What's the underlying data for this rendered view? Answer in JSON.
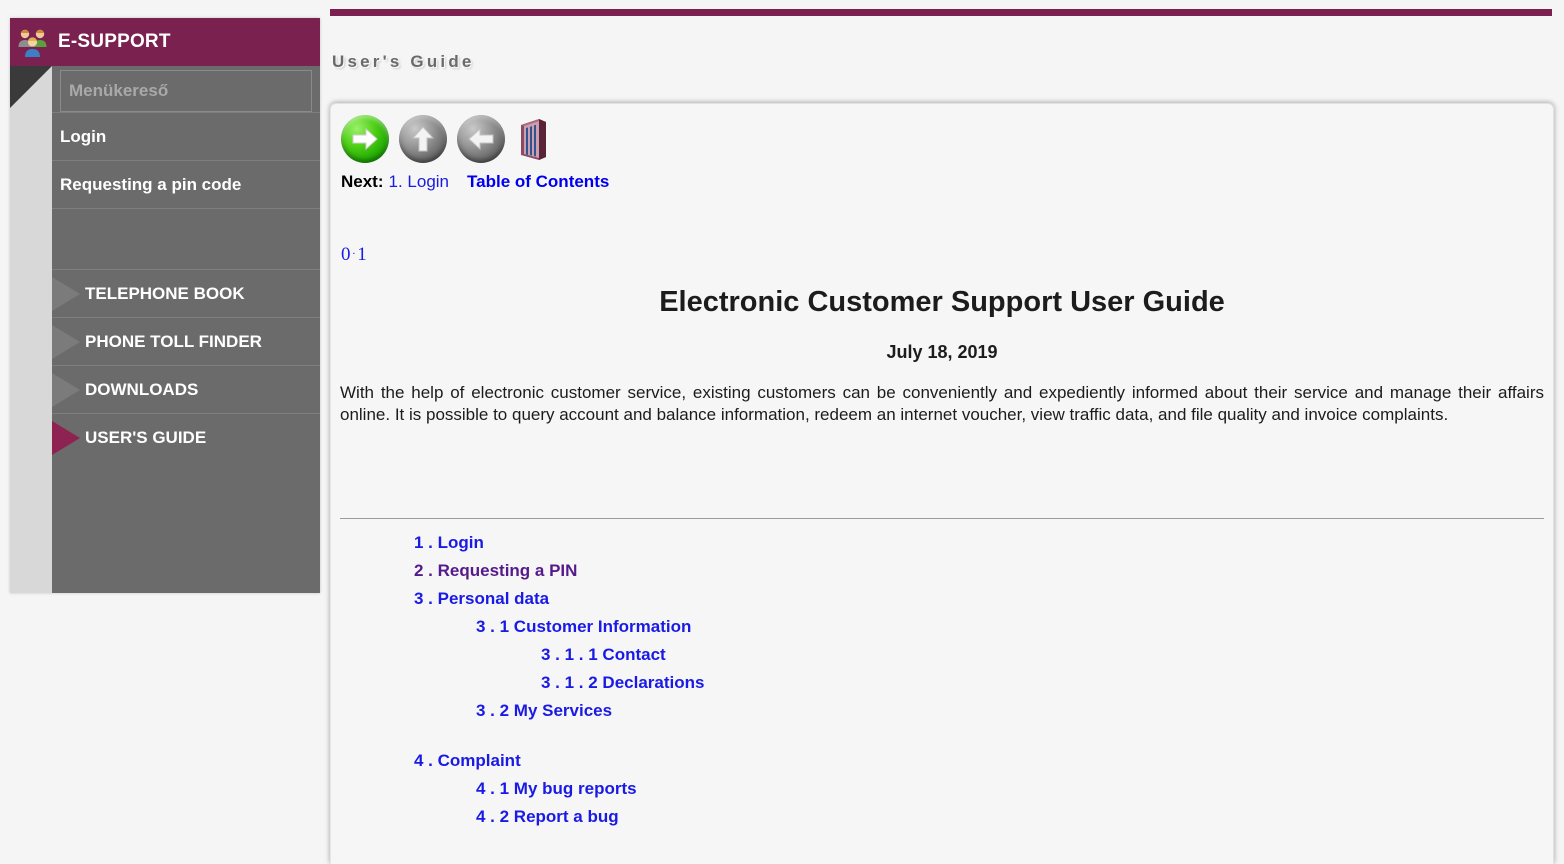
{
  "sidebar": {
    "brand": "E-SUPPORT",
    "logo_icon": "people-group-icon",
    "search_placeholder": "Menükereső",
    "search_value": "",
    "items": [
      {
        "label": "Login",
        "style": "plain",
        "active": false
      },
      {
        "label": "Requesting a pin code",
        "style": "plain",
        "active": false
      }
    ],
    "section_items": [
      {
        "label": "TELEPHONE BOOK",
        "active": false
      },
      {
        "label": "PHONE TOLL FINDER",
        "active": false
      },
      {
        "label": "DOWNLOADS",
        "active": false
      },
      {
        "label": "USER'S GUIDE",
        "active": true
      }
    ]
  },
  "page": {
    "title": "User's Guide"
  },
  "nav": {
    "forward_icon": "arrow-right-green-icon",
    "up_icon": "arrow-up-gray-icon",
    "back_icon": "arrow-left-gray-icon",
    "contents_icon": "book-icon",
    "next_label": "Next:",
    "next_link": "1. Login",
    "toc_link": "Table of Contents"
  },
  "version": {
    "major": "0",
    "separator": ".",
    "minor": "1"
  },
  "document": {
    "title": "Electronic Customer Support User Guide",
    "date": "July 18, 2019",
    "abstract": "With the help of electronic customer service, existing customers can be conveniently and expediently informed about their service and manage their affairs online. It is possible to query account and balance information, redeem an internet voucher, view traffic data, and file quality and invoice complaints."
  },
  "toc": [
    {
      "text": "1 . Login",
      "level": 1,
      "visited": false
    },
    {
      "text": "2 . Requesting a PIN",
      "level": 1,
      "visited": true
    },
    {
      "text": "3 . Personal data",
      "level": 1,
      "visited": false
    },
    {
      "text": "3 . 1 Customer Information",
      "level": 2,
      "visited": false
    },
    {
      "text": "3 . 1 . 1 Contact",
      "level": 3,
      "visited": false
    },
    {
      "text": "3 . 1 . 2 Declarations",
      "level": 3,
      "visited": false
    },
    {
      "text": "3 . 2 My Services",
      "level": 2,
      "visited": false
    },
    {
      "text": "",
      "level": 0,
      "visited": false
    },
    {
      "text": "4 . Complaint",
      "level": 1,
      "visited": false
    },
    {
      "text": "4 . 1 My bug reports",
      "level": 2,
      "visited": false
    },
    {
      "text": "4 . 2 Report a bug",
      "level": 2,
      "visited": false
    }
  ],
  "colors": {
    "brand_maroon": "#7b2150",
    "sidebar_gray": "#6b6b6b",
    "link_blue": "#1a1ae6",
    "visited_purple": "#551a8b",
    "page_bg": "#f5f5f5"
  }
}
